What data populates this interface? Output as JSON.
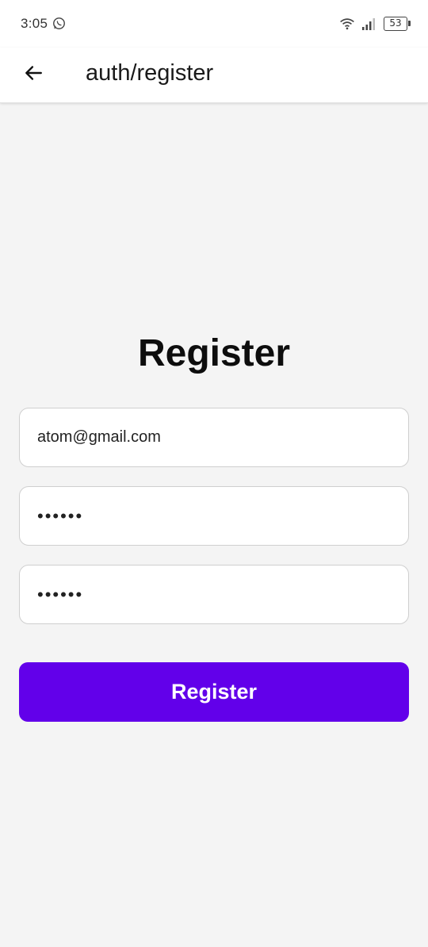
{
  "status_bar": {
    "time": "3:05",
    "battery": "53",
    "icons": [
      "whatsapp-icon",
      "wifi-icon",
      "signal-icon",
      "battery-icon"
    ]
  },
  "app_bar": {
    "back_icon": "arrow-left-icon",
    "title": "auth/register"
  },
  "form": {
    "heading": "Register",
    "email_value": "atom@gmail.com",
    "password_value": "••••••",
    "confirm_password_value": "••••••",
    "submit_label": "Register"
  },
  "colors": {
    "primary": "#6200ea",
    "background": "#f4f4f4",
    "surface": "#ffffff",
    "field_border": "#cfcfcf"
  }
}
